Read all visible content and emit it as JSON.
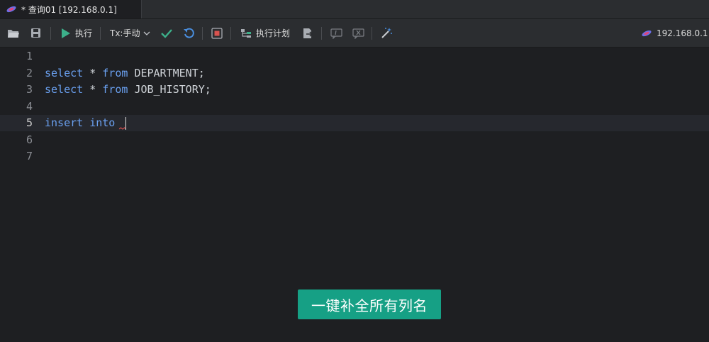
{
  "tab": {
    "title": "* 查询01 [192.168.0.1]",
    "icon": "database-connection-icon"
  },
  "toolbar": {
    "open_icon": "folder-open-icon",
    "save_icon": "save-icon",
    "run_label": "执行",
    "tx_label": "Tx:手动",
    "commit_icon": "check-icon",
    "rollback_icon": "undo-icon",
    "stop_icon": "stop-icon",
    "plan_label": "执行计划",
    "connection_label": "192.168.0.1",
    "colors": {
      "run": "#3cb08a",
      "commit": "#3cb08a",
      "rollback": "#4a8fe0",
      "stop": "#d9534f"
    }
  },
  "editor": {
    "lines": [
      {
        "number": "1",
        "text": ""
      },
      {
        "number": "2",
        "text": "select * from DEPARTMENT;"
      },
      {
        "number": "3",
        "text": "select * from JOB_HISTORY;"
      },
      {
        "number": "4",
        "text": ""
      },
      {
        "number": "5",
        "text": "insert into "
      },
      {
        "number": "6",
        "text": ""
      },
      {
        "number": "7",
        "text": ""
      }
    ],
    "current_line": "5",
    "keyword_color": "#6aa0f0"
  },
  "hint": {
    "text": "一键补全所有列名",
    "color": "#16a085"
  }
}
